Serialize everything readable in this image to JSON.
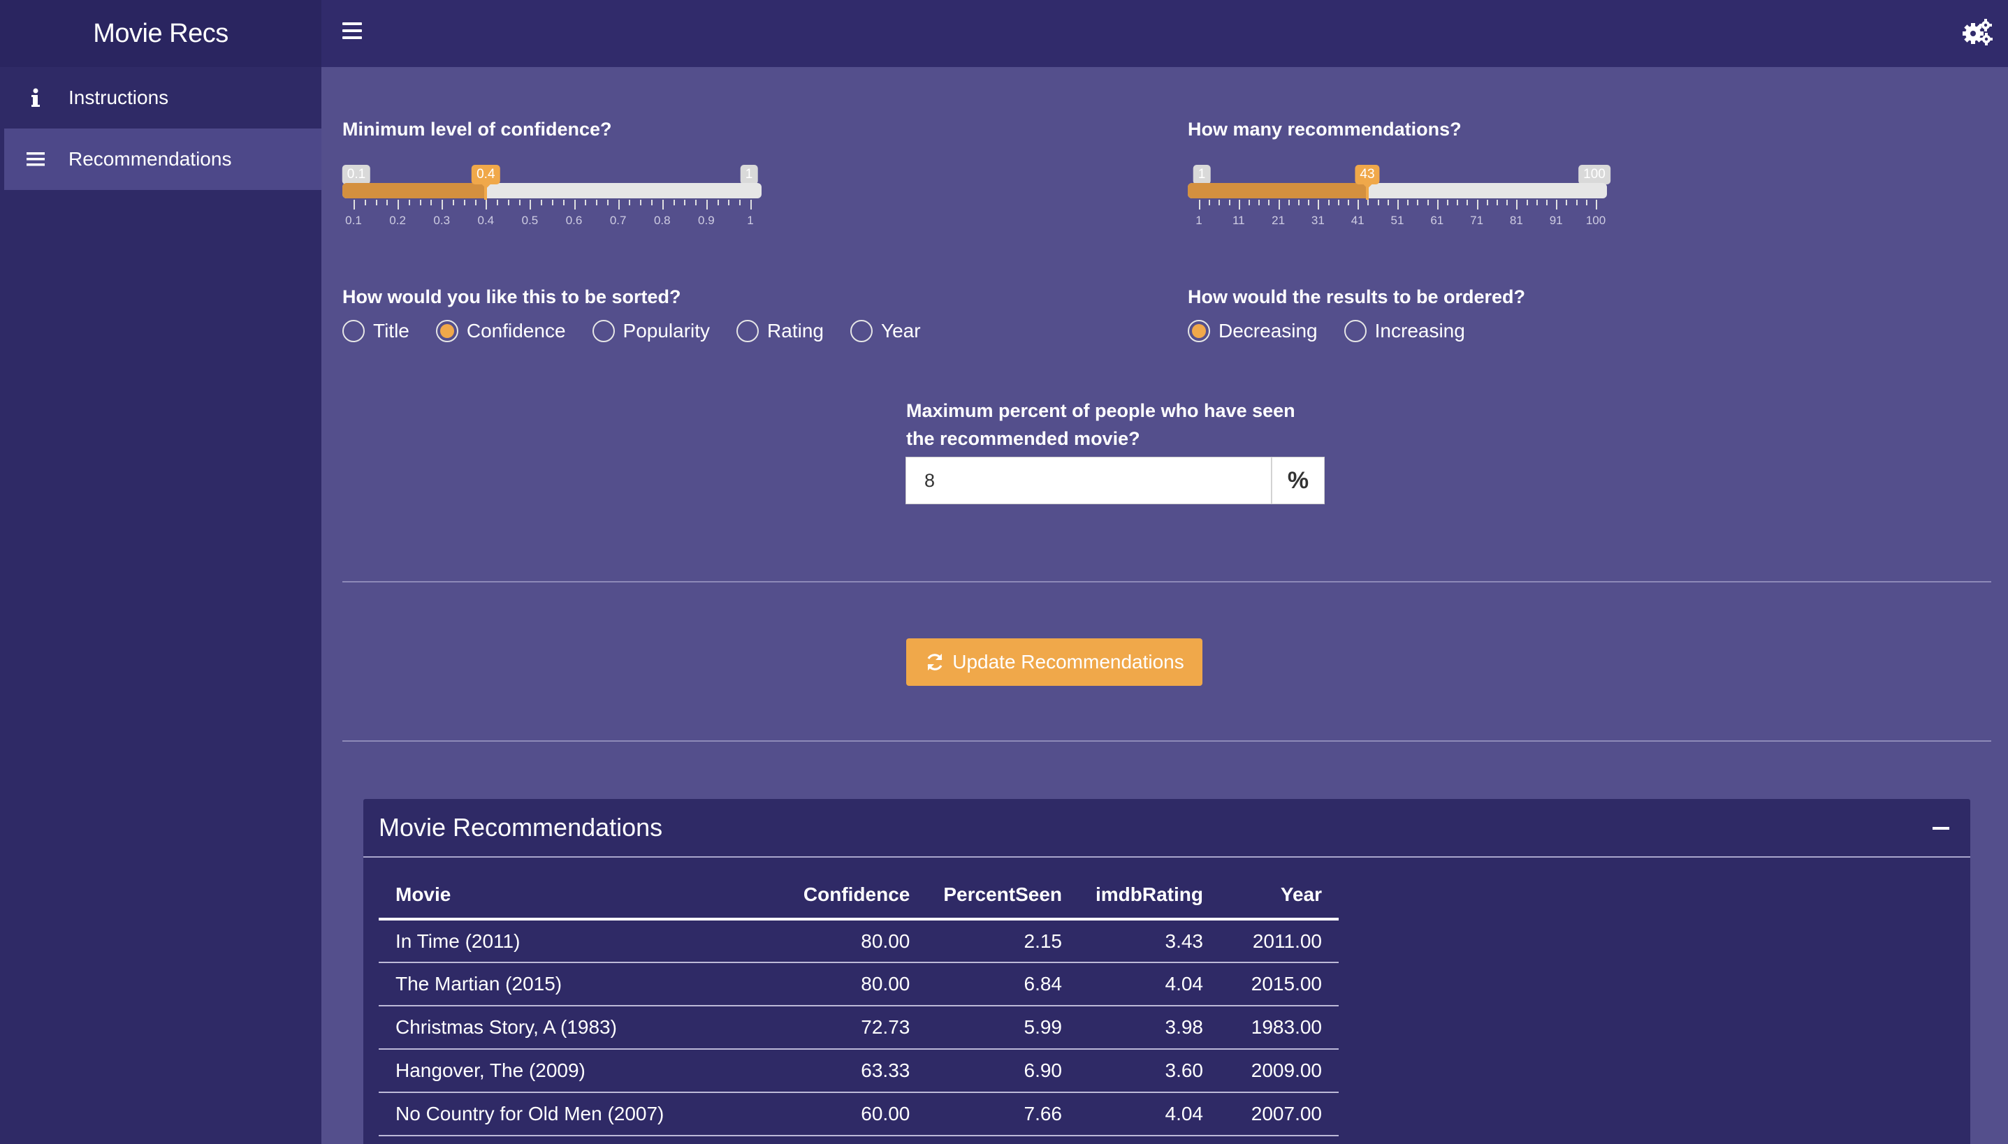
{
  "app": {
    "title": "Movie Recs"
  },
  "sidebar": {
    "items": [
      {
        "label": "Instructions",
        "icon": "info-icon",
        "active": false
      },
      {
        "label": "Recommendations",
        "icon": "list-icon",
        "active": true
      }
    ]
  },
  "header": {
    "menu_icon": "hamburger-icon",
    "settings_icon": "gears-icon"
  },
  "colors": {
    "sidebar": "#2f2a66",
    "content": "#544f8c",
    "accent": "#f0a84a",
    "slider_fill": "#d4903f"
  },
  "confidence": {
    "label": "Minimum level of confidence?",
    "min": 0.1,
    "max": 1,
    "value": 0.4,
    "min_label": "0.1",
    "max_label": "1",
    "value_label": "0.4",
    "tick_labels": [
      "0.1",
      "0.2",
      "0.3",
      "0.4",
      "0.5",
      "0.6",
      "0.7",
      "0.8",
      "0.9",
      "1"
    ]
  },
  "count": {
    "label": "How many recommendations?",
    "min": 1,
    "max": 100,
    "value": 43,
    "min_label": "1",
    "max_label": "100",
    "value_label": "43",
    "tick_labels": [
      "1",
      "11",
      "21",
      "31",
      "41",
      "51",
      "61",
      "71",
      "81",
      "91",
      "100"
    ]
  },
  "sort": {
    "label": "How would you like this to be sorted?",
    "options": [
      "Title",
      "Confidence",
      "Popularity",
      "Rating",
      "Year"
    ],
    "selected": "Confidence"
  },
  "order": {
    "label": "How would the results to be ordered?",
    "options": [
      "Decreasing",
      "Increasing"
    ],
    "selected": "Decreasing"
  },
  "percent": {
    "label_line1": "Maximum percent of people who have seen",
    "label_line2": "the recommended movie?",
    "value": "8",
    "addon": "%"
  },
  "update_button": {
    "label": "Update Recommendations",
    "icon": "refresh-icon"
  },
  "results": {
    "title": "Movie Recommendations",
    "columns": [
      "Movie",
      "Confidence",
      "PercentSeen",
      "imdbRating",
      "Year"
    ],
    "rows": [
      [
        "In Time (2011)",
        "80.00",
        "2.15",
        "3.43",
        "2011.00"
      ],
      [
        "The Martian (2015)",
        "80.00",
        "6.84",
        "4.04",
        "2015.00"
      ],
      [
        "Christmas Story, A (1983)",
        "72.73",
        "5.99",
        "3.98",
        "1983.00"
      ],
      [
        "Hangover, The (2009)",
        "63.33",
        "6.90",
        "3.60",
        "2009.00"
      ],
      [
        "No Country for Old Men (2007)",
        "60.00",
        "7.66",
        "4.04",
        "2007.00"
      ]
    ]
  }
}
